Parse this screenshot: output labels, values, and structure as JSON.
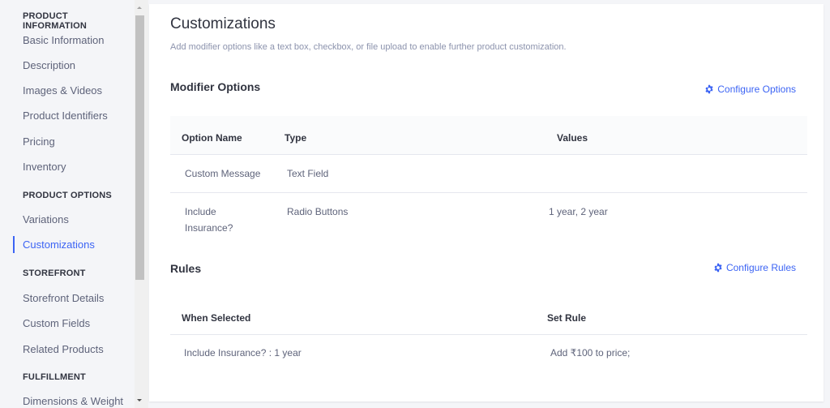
{
  "sidebar": {
    "sections": [
      {
        "heading": "PRODUCT INFORMATION",
        "items": [
          "Basic Information",
          "Description",
          "Images & Videos",
          "Product Identifiers",
          "Pricing",
          "Inventory"
        ]
      },
      {
        "heading": "PRODUCT OPTIONS",
        "items": [
          "Variations",
          "Customizations"
        ]
      },
      {
        "heading": "STOREFRONT",
        "items": [
          "Storefront Details",
          "Custom Fields",
          "Related Products"
        ]
      },
      {
        "heading": "FULFILLMENT",
        "items": [
          "Dimensions & Weight"
        ]
      }
    ],
    "active_item": "Customizations"
  },
  "main": {
    "title": "Customizations",
    "description": "Add modifier options like a text box, checkbox, or file upload to enable further product customization.",
    "modifier_options": {
      "title": "Modifier Options",
      "configure_label": "Configure Options",
      "configure_icon": "gear-icon",
      "columns": [
        "Option Name",
        "Type",
        "Values"
      ],
      "rows": [
        {
          "name": "Custom Message",
          "type": "Text Field",
          "values": ""
        },
        {
          "name": "Include Insurance?",
          "name_line1": "Include",
          "name_line2": "Insurance?",
          "type": "Radio Buttons",
          "values": "1 year, 2 year"
        }
      ]
    },
    "rules": {
      "title": "Rules",
      "configure_label": "Configure Rules",
      "configure_icon": "gear-icon",
      "columns": [
        "When Selected",
        "Set Rule"
      ],
      "rows": [
        {
          "when_selected": "Include Insurance? : 1 year",
          "set_rule": "Add ₹100 to price;"
        }
      ]
    }
  },
  "colors": {
    "accent": "#3c64f4",
    "background": "#f4f5f8",
    "panel": "#ffffff",
    "text_primary": "#313440",
    "text_secondary": "#5e637a"
  }
}
